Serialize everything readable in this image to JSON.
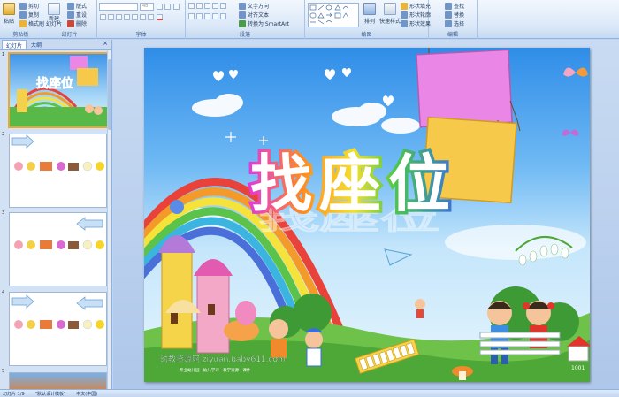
{
  "ribbon": {
    "clipboard": {
      "label": "剪贴板",
      "paste": "粘贴",
      "cut": "剪切",
      "copy": "复制",
      "format_painter": "格式刷"
    },
    "slides": {
      "label": "幻灯片",
      "new_slide": "新建\n幻灯片",
      "layout": "版式",
      "reset": "重设",
      "delete": "删除"
    },
    "font": {
      "label": "字体",
      "font_placeholder": "",
      "size": "48"
    },
    "paragraph": {
      "label": "段落",
      "text_direction": "文字方向",
      "align_text": "对齐文本",
      "smartart": "转换为 SmartArt"
    },
    "drawing": {
      "label": "绘图",
      "arrange": "排列",
      "quick_styles": "快速样式",
      "shape_fill": "形状填充",
      "shape_outline": "形状轮廓",
      "shape_effects": "形状效果"
    },
    "editing": {
      "label": "编辑",
      "find": "查找",
      "replace": "替换",
      "select": "选择"
    }
  },
  "leftpane": {
    "tabs": [
      "幻灯片",
      "大纲"
    ],
    "close": "×",
    "slides": [
      {
        "number": "1"
      },
      {
        "number": "2"
      },
      {
        "number": "3"
      },
      {
        "number": "4"
      },
      {
        "number": "5"
      }
    ]
  },
  "slide": {
    "title": "找座位",
    "watermark_main": "幼教资源网 ziyuan.baby611.com",
    "watermark_sub": "专业幼儿园 · 幼儿学习 · 教学资源 · 课件",
    "sign_number": "1001"
  },
  "status": {
    "slide_counter": "幻灯片 1/9",
    "theme": "\"默认设计模板\"",
    "language": "中文(中国)"
  },
  "colors": {
    "ribbon_bg": "#dbe8f8",
    "accent_border": "#8db2e3",
    "selection": "#f0a52c",
    "pink_board": "#e986e6",
    "yellow_board": "#f7c94a"
  }
}
